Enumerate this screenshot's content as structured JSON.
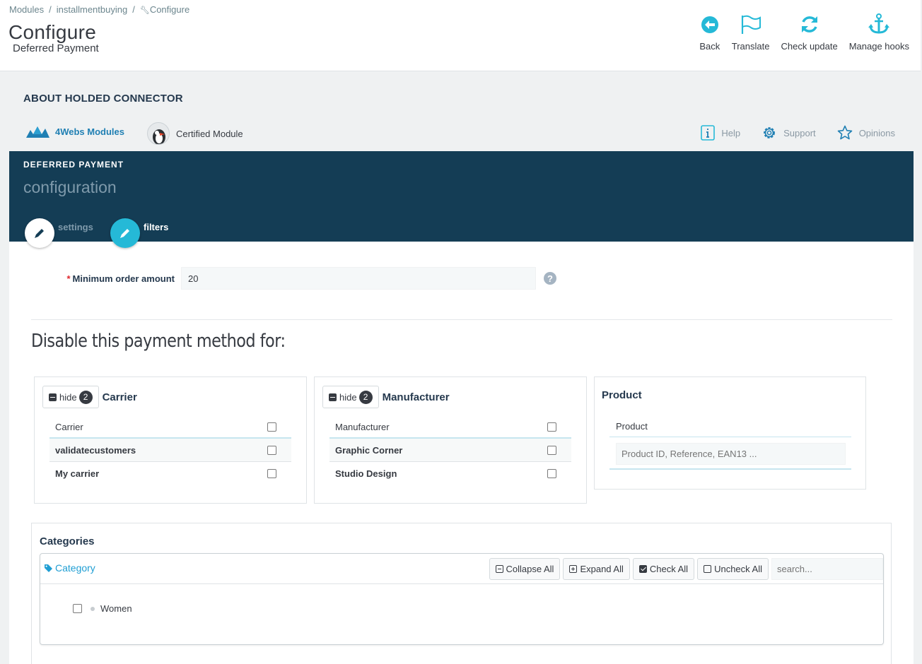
{
  "breadcrumb": [
    "Modules",
    "installmentbuying",
    "Configure"
  ],
  "header": {
    "title": "Configure",
    "subtitle": "Deferred Payment"
  },
  "toolbar": [
    {
      "label": "Back",
      "icon": "back-circle-icon"
    },
    {
      "label": "Translate",
      "icon": "flag-icon"
    },
    {
      "label": "Check update",
      "icon": "refresh-icon"
    },
    {
      "label": "Manage hooks",
      "icon": "anchor-icon"
    }
  ],
  "about": {
    "title": "ABOUT HOLDED CONNECTOR",
    "vendor": "4Webs Modules",
    "certified": "Certified Module",
    "links": [
      {
        "label": "Help",
        "icon": "info-icon"
      },
      {
        "label": "Support",
        "icon": "gear-icon"
      },
      {
        "label": "Opinions",
        "icon": "star-icon"
      }
    ]
  },
  "panel": {
    "kicker": "DEFERRED PAYMENT",
    "heading": "configuration",
    "tabs": [
      {
        "label": "settings",
        "active": false
      },
      {
        "label": "filters",
        "active": true
      }
    ]
  },
  "form": {
    "min_order_label": "Minimum order amount",
    "required_mark": "*",
    "min_order_value": "20",
    "help": "?"
  },
  "disable_title": "Disable this payment method for:",
  "carrier_box": {
    "hide_label": "hide",
    "count": "2",
    "title": "Carrier",
    "header": "Carrier",
    "rows": [
      "validatecustomers",
      "My carrier"
    ]
  },
  "manufacturer_box": {
    "hide_label": "hide",
    "count": "2",
    "title": "Manufacturer",
    "header": "Manufacturer",
    "rows": [
      "Graphic Corner",
      "Studio Design"
    ]
  },
  "product_box": {
    "title": "Product",
    "header": "Product",
    "placeholder": "Product ID, Reference, EAN13 ..."
  },
  "categories": {
    "title": "Categories",
    "tree_label": "Category",
    "collapse": "Collapse All",
    "expand": "Expand All",
    "check": "Check All",
    "uncheck": "Uncheck All",
    "search_placeholder": "search...",
    "items": [
      "Women"
    ]
  },
  "colors": {
    "accent": "#25b9d7",
    "panel_head": "#143d55",
    "link": "#1f7fb3"
  }
}
